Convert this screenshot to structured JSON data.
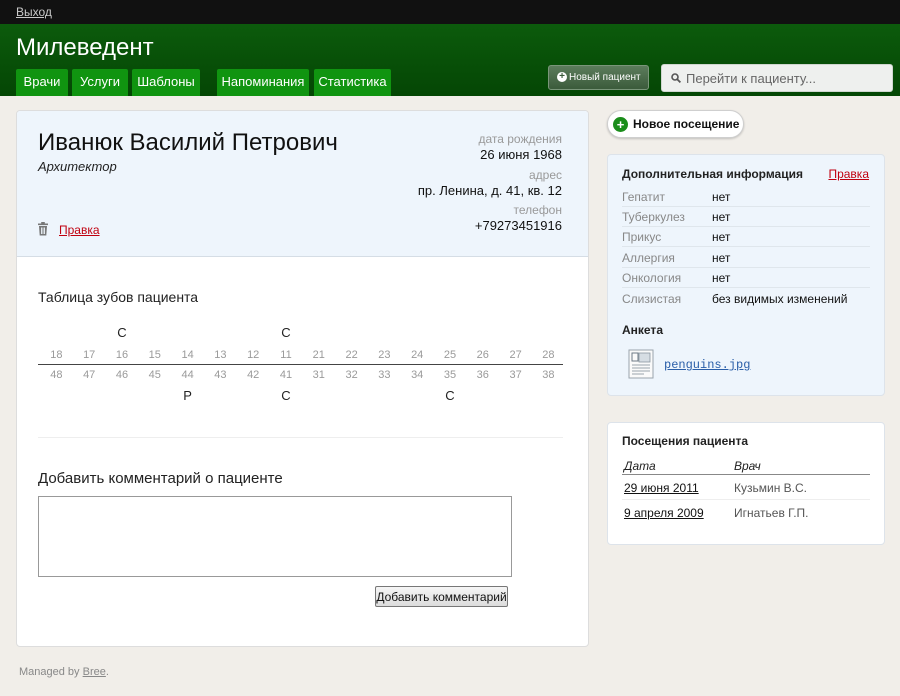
{
  "topbar": {
    "logout": "Выход"
  },
  "header": {
    "title": "Милеведент",
    "nav": [
      "Врачи",
      "Услуги",
      "Шаблоны",
      "Напоминания",
      "Статистика"
    ],
    "new_patient": "Новый пациент",
    "search_placeholder": "Перейти к пациенту..."
  },
  "patient": {
    "name": "Иванюк Василий Петрович",
    "job": "Архитектор",
    "edit": "Правка",
    "birth_label": "дата рождения",
    "birth": "26 июня 1968",
    "address_label": "адрес",
    "address": "пр. Ленина, д. 41, кв. 12",
    "phone_label": "телефон",
    "phone": "+79273451916"
  },
  "teeth": {
    "title": "Таблица зубов пациента",
    "upper": [
      "18",
      "17",
      "16",
      "15",
      "14",
      "13",
      "12",
      "11",
      "21",
      "22",
      "23",
      "24",
      "25",
      "26",
      "27",
      "28"
    ],
    "lower": [
      "48",
      "47",
      "46",
      "45",
      "44",
      "43",
      "42",
      "41",
      "31",
      "32",
      "33",
      "34",
      "35",
      "36",
      "37",
      "38"
    ],
    "upper_marks": [
      "",
      "",
      "С",
      "",
      "",
      "",
      "",
      "С",
      "",
      "",
      "",
      "",
      "",
      "",
      "",
      ""
    ],
    "lower_marks": [
      "",
      "",
      "",
      "",
      "Р",
      "",
      "",
      "С",
      "",
      "",
      "",
      "",
      "С",
      "",
      "",
      ""
    ]
  },
  "comment": {
    "title": "Добавить комментарий о пациенте",
    "button": "Добавить комментарий",
    "value": ""
  },
  "sidebar": {
    "new_visit": "Новое посещение",
    "additional": {
      "title": "Дополнительная информация",
      "edit": "Правка",
      "rows": [
        {
          "k": "Гепатит",
          "v": "нет"
        },
        {
          "k": "Туберкулез",
          "v": "нет"
        },
        {
          "k": "Прикус",
          "v": "нет"
        },
        {
          "k": "Аллергия",
          "v": "нет"
        },
        {
          "k": "Онкология",
          "v": "нет"
        },
        {
          "k": "Слизистая",
          "v": "без видимых изменений"
        }
      ],
      "anketa_title": "Анкета",
      "file": "penguins.jpg"
    },
    "visits": {
      "title": "Посещения пациента",
      "date_header": "Дата",
      "doctor_header": "Врач",
      "rows": [
        {
          "date": "29 июня 2011",
          "doctor": "Кузьмин В.С."
        },
        {
          "date": "9 апреля 2009",
          "doctor": "Игнатьев Г.П."
        }
      ]
    }
  },
  "footer": {
    "prefix": "Managed by ",
    "link": "Bree",
    "suffix": "."
  }
}
